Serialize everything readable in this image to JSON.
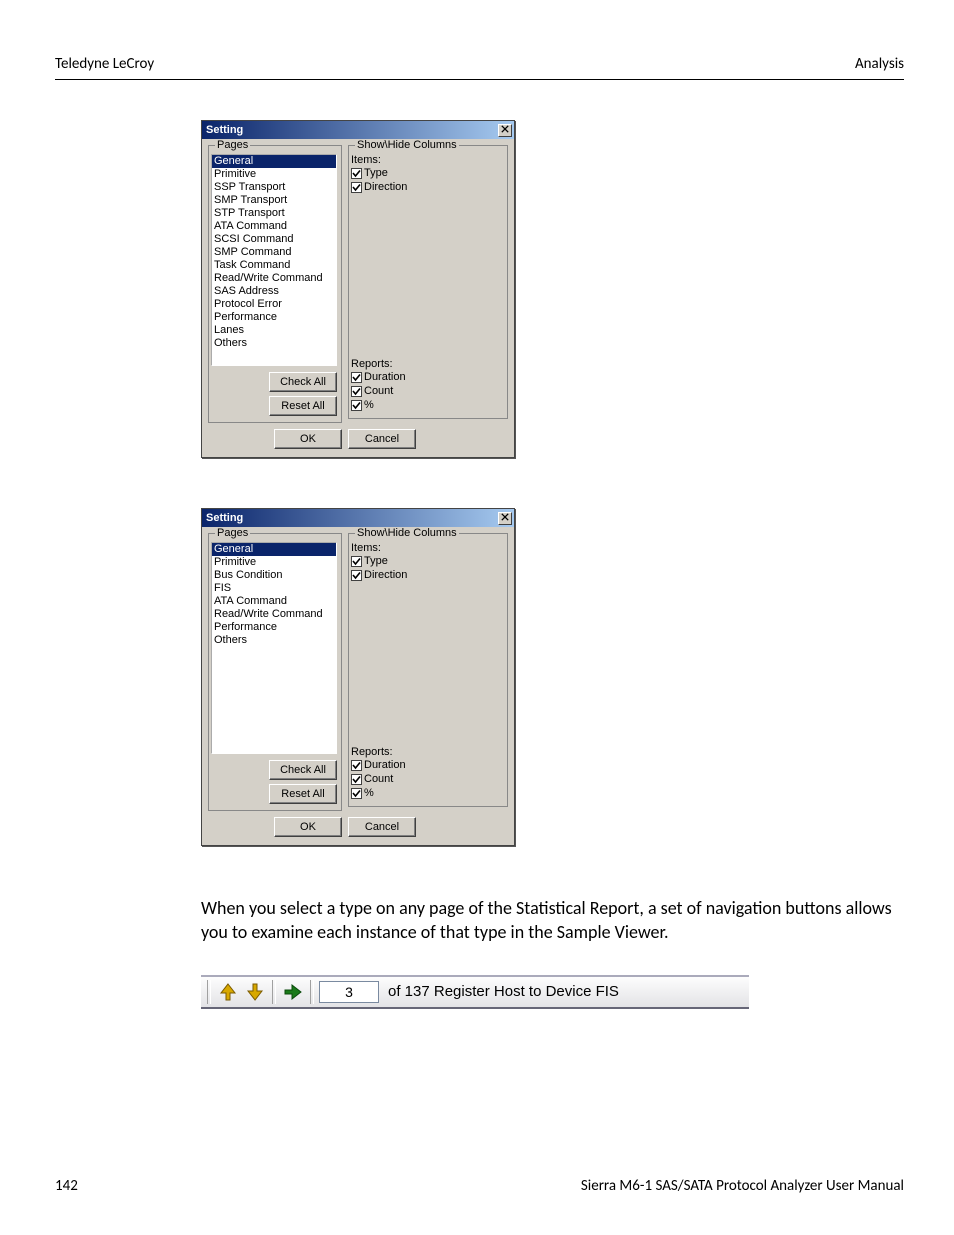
{
  "header": {
    "left": "Teledyne LeCroy",
    "right": "Analysis"
  },
  "dialog1": {
    "title": "Setting",
    "pages_label": "Pages",
    "pages": [
      {
        "label": "General",
        "selected": true
      },
      {
        "label": "Primitive"
      },
      {
        "label": "SSP Transport"
      },
      {
        "label": "SMP Transport"
      },
      {
        "label": "STP Transport"
      },
      {
        "label": "ATA Command"
      },
      {
        "label": "SCSI Command"
      },
      {
        "label": "SMP Command"
      },
      {
        "label": "Task Command"
      },
      {
        "label": "Read/Write Command"
      },
      {
        "label": "SAS Address"
      },
      {
        "label": "Protocol Error"
      },
      {
        "label": "Performance"
      },
      {
        "label": "Lanes"
      },
      {
        "label": "Others"
      }
    ],
    "check_all": "Check All",
    "reset_all": "Reset All",
    "showhide_label": "Show\\Hide Columns",
    "items_label": "Items:",
    "items": [
      {
        "label": "Type",
        "checked": true
      },
      {
        "label": "Direction",
        "checked": true
      }
    ],
    "reports_label": "Reports:",
    "reports": [
      {
        "label": "Duration",
        "checked": true
      },
      {
        "label": "Count",
        "checked": true
      },
      {
        "label": "%",
        "checked": true
      }
    ],
    "ok": "OK",
    "cancel": "Cancel"
  },
  "dialog2": {
    "title": "Setting",
    "pages_label": "Pages",
    "pages": [
      {
        "label": "General",
        "selected": true
      },
      {
        "label": "Primitive"
      },
      {
        "label": "Bus Condition"
      },
      {
        "label": "FIS"
      },
      {
        "label": "ATA Command"
      },
      {
        "label": "Read/Write Command"
      },
      {
        "label": "Performance"
      },
      {
        "label": "Others"
      }
    ],
    "check_all": "Check All",
    "reset_all": "Reset All",
    "showhide_label": "Show\\Hide Columns",
    "items_label": "Items:",
    "items": [
      {
        "label": "Type",
        "checked": true
      },
      {
        "label": "Direction",
        "checked": true
      }
    ],
    "reports_label": "Reports:",
    "reports": [
      {
        "label": "Duration",
        "checked": true
      },
      {
        "label": "Count",
        "checked": true
      },
      {
        "label": "%",
        "checked": true
      }
    ],
    "ok": "OK",
    "cancel": "Cancel"
  },
  "body_text": "When you select a type on any page of the Statistical Report, a set of navigation buttons allows you to examine each instance of that type in the Sample Viewer.",
  "nav": {
    "value": "3",
    "of_text": "of 137  Register Host to Device  FIS"
  },
  "footer": {
    "page_num": "142",
    "manual": "Sierra M6-1 SAS/SATA Protocol Analyzer User Manual"
  }
}
